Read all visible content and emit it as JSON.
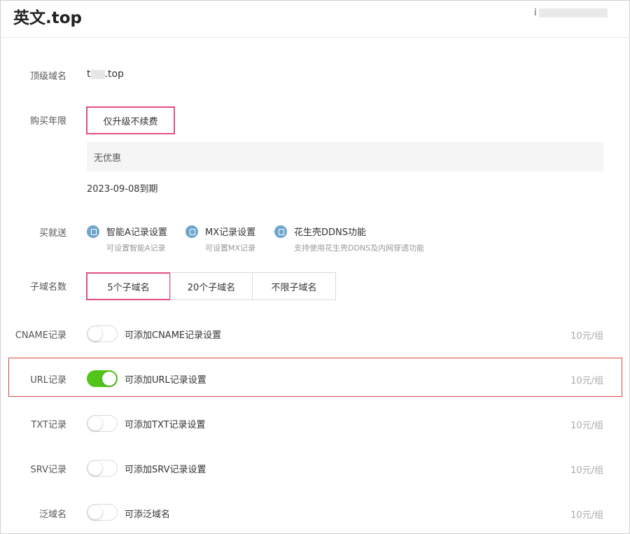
{
  "header": {
    "title": "英文.top",
    "account_prefix": "i"
  },
  "domain": {
    "label": "顶级域名",
    "value_prefix": "t",
    "value_suffix": ".top"
  },
  "purchase": {
    "label": "购买年限",
    "option": "仅升级不续费",
    "discount": "无优惠",
    "expiry": "2023-09-08到期"
  },
  "gifts": {
    "label": "买就送",
    "items": [
      {
        "title": "智能A记录设置",
        "sub": "可设置智能A记录",
        "icon": "tag-icon"
      },
      {
        "title": "MX记录设置",
        "sub": "可设置MX记录",
        "icon": "tag-icon"
      },
      {
        "title": "花生壳DDNS功能",
        "sub": "支持使用花生壳DDNS及内网穿透功能",
        "icon": "tag-icon"
      }
    ]
  },
  "subdomains": {
    "label": "子域名数",
    "options": [
      "5个子域名",
      "20个子域名",
      "不限子域名"
    ],
    "selected": "5个子域名"
  },
  "records": [
    {
      "label": "CNAME记录",
      "text": "可添加CNAME记录设置",
      "price": "10元/组",
      "on": false
    },
    {
      "label": "URL记录",
      "text": "可添加URL记录设置",
      "price": "10元/组",
      "on": true
    },
    {
      "label": "TXT记录",
      "text": "可添加TXT记录设置",
      "price": "10元/组",
      "on": false
    },
    {
      "label": "SRV记录",
      "text": "可添加SRV记录设置",
      "price": "10元/组",
      "on": false
    },
    {
      "label": "泛域名",
      "text": "可添泛域名",
      "price": "10元/组",
      "on": false
    }
  ],
  "colors": {
    "selected_border": "#e2507e",
    "toggle_on": "#52c41a",
    "highlight": "#e04040"
  }
}
